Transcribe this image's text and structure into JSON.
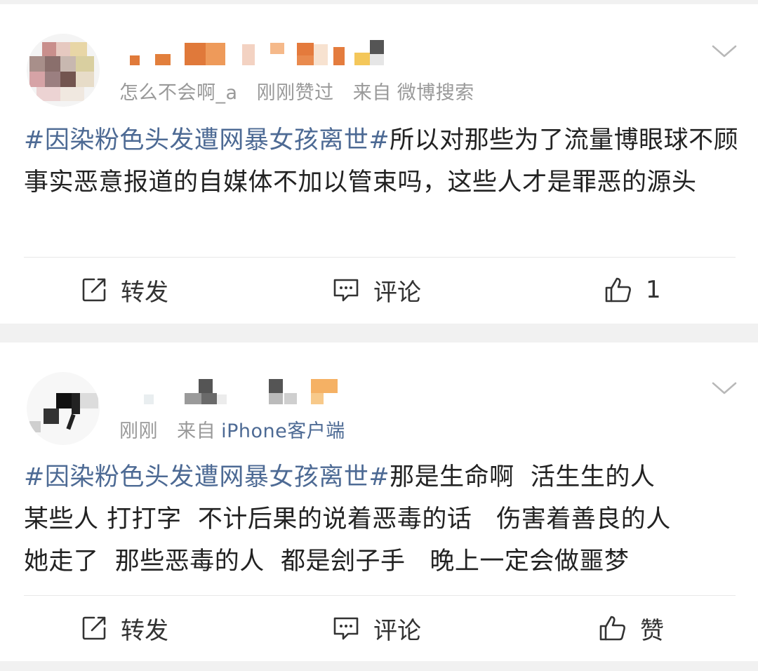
{
  "posts": [
    {
      "meta": {
        "user_handle": "怎么不会啊_a",
        "time": "刚刚赞过",
        "source_prefix": "来自",
        "source": "微博搜索"
      },
      "content": {
        "hashtag": "#因染粉色头发遭网暴女孩离世#",
        "text": "所以对那些为了流量博眼球不顾事实恶意报道的自媒体不加以管束吗，这些人才是罪恶的源头"
      },
      "actions": {
        "repost": "转发",
        "comment": "评论",
        "like": "1"
      }
    },
    {
      "meta": {
        "time": "刚刚",
        "source_prefix": "来自",
        "source": "iPhone客户端"
      },
      "content": {
        "hashtag": "#因染粉色头发遭网暴女孩离世#",
        "text": "那是生命啊  活生生的人\n某些人 打打字  不计后果的说着恶毒的话   伤害着善良的人\n她走了  那些恶毒的人  都是刽子手   晚上一定会做噩梦"
      },
      "actions": {
        "repost": "转发",
        "comment": "评论",
        "like": "赞"
      }
    }
  ],
  "colors": {
    "hashtag": "#4d6a94",
    "meta_text": "#999999",
    "body_text": "#222222",
    "background": "#f1f1f1"
  },
  "icons": [
    "repost-icon",
    "comment-icon",
    "thumbs-up-icon",
    "chevron-down-icon"
  ]
}
